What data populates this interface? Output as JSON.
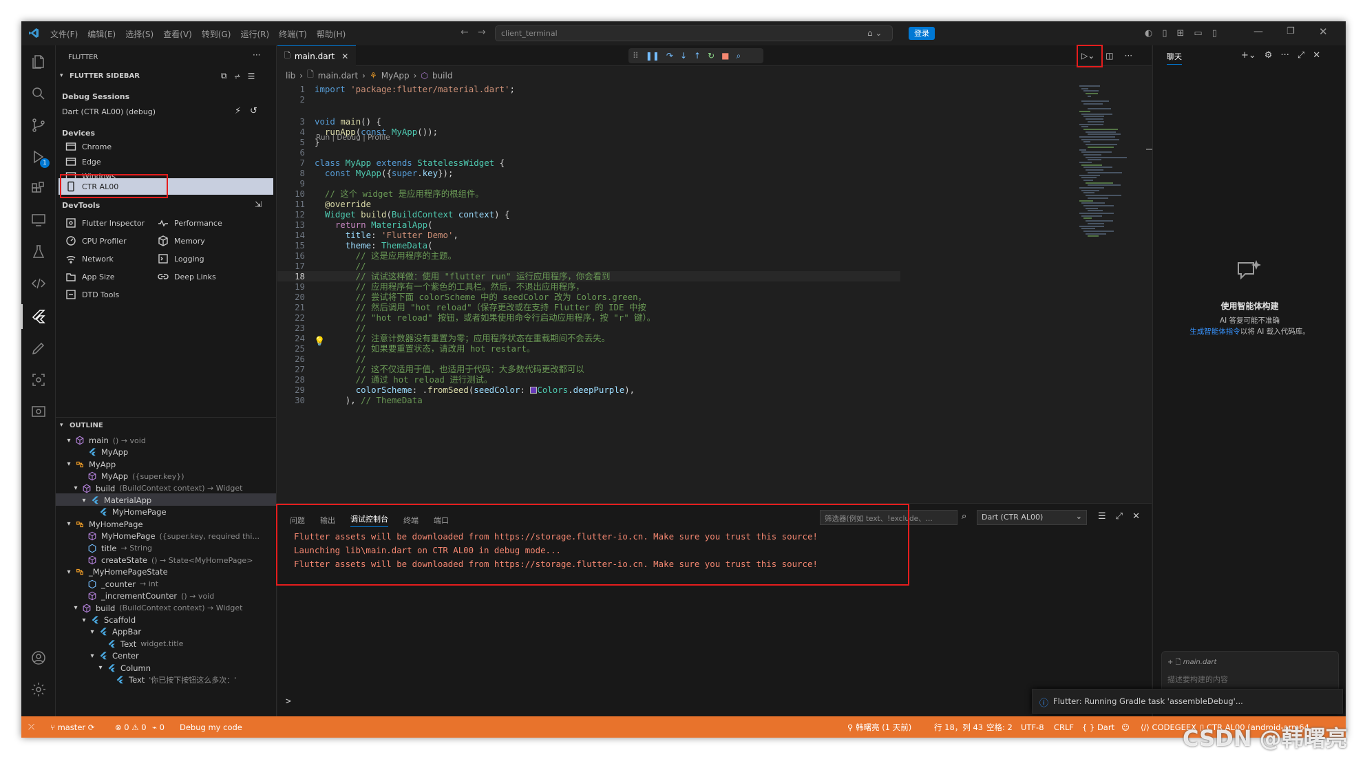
{
  "titlebar": {
    "menus": [
      "文件(F)",
      "编辑(E)",
      "选择(S)",
      "查看(V)",
      "转到(G)",
      "运行(R)",
      "终端(T)",
      "帮助(H)"
    ],
    "search_placeholder": "client_terminal",
    "login_label": "登录"
  },
  "sidebar": {
    "header": "FLUTTER",
    "section_title": "FLUTTER SIDEBAR",
    "debug_sessions_label": "Debug Sessions",
    "debug_session": "Dart  (CTR AL00) (debug)",
    "devices_label": "Devices",
    "devices": [
      "Chrome",
      "Edge",
      "Windows",
      "CTR AL00"
    ],
    "devtools_label": "DevTools",
    "devtools_left": [
      "Flutter Inspector",
      "CPU Profiler",
      "Network",
      "App Size",
      "DTD Tools"
    ],
    "devtools_right": [
      "Performance",
      "Memory",
      "Logging",
      "Deep Links"
    ]
  },
  "outline": {
    "header": "OUTLINE",
    "items": [
      {
        "label": "main",
        "detail": "() → void"
      },
      {
        "label": "MyApp",
        "detail": ""
      },
      {
        "label": "MyApp",
        "detail": ""
      },
      {
        "label": "MyApp",
        "detail": "({super.key})"
      },
      {
        "label": "build",
        "detail": "(BuildContext context) → Widget"
      },
      {
        "label": "MaterialApp",
        "detail": ""
      },
      {
        "label": "MyHomePage",
        "detail": ""
      },
      {
        "label": "MyHomePage",
        "detail": ""
      },
      {
        "label": "MyHomePage",
        "detail": "({super.key, required thi..."
      },
      {
        "label": "title",
        "detail": "→ String"
      },
      {
        "label": "createState",
        "detail": "() → State<MyHomePage>"
      },
      {
        "label": "_MyHomePageState",
        "detail": ""
      },
      {
        "label": "_counter",
        "detail": "→ int"
      },
      {
        "label": "_incrementCounter",
        "detail": "() → void"
      },
      {
        "label": "build",
        "detail": "(BuildContext context) → Widget"
      },
      {
        "label": "Scaffold",
        "detail": ""
      },
      {
        "label": "AppBar",
        "detail": ""
      },
      {
        "label": "Text",
        "detail": "widget.title"
      },
      {
        "label": "Center",
        "detail": ""
      },
      {
        "label": "Column",
        "detail": ""
      },
      {
        "label": "Text",
        "detail": "'你已按下按钮这么多次：'"
      }
    ]
  },
  "editor": {
    "tab_label": "main.dart",
    "breadcrumb": [
      "lib",
      "main.dart",
      "MyApp",
      "build"
    ],
    "codelens": "Run | Debug | Profile"
  },
  "code": [
    {
      "n": "1",
      "t": [
        [
          "kw",
          "import "
        ],
        [
          "st",
          "'package:flutter/material.dart'"
        ],
        [
          "pl",
          ";"
        ]
      ]
    },
    {
      "n": "2",
      "t": []
    },
    {
      "n": "3",
      "t": [
        [
          "kw",
          "void "
        ],
        [
          "fn",
          "main"
        ],
        [
          "pl",
          "() {"
        ]
      ]
    },
    {
      "n": "4",
      "t": [
        [
          "pl",
          "  "
        ],
        [
          "fn",
          "runApp"
        ],
        [
          "pl",
          "("
        ],
        [
          "kw",
          "const "
        ],
        [
          "ty",
          "MyApp"
        ],
        [
          "pl",
          "());"
        ]
      ]
    },
    {
      "n": "5",
      "t": [
        [
          "pl",
          "}"
        ]
      ]
    },
    {
      "n": "6",
      "t": []
    },
    {
      "n": "7",
      "t": [
        [
          "kw",
          "class "
        ],
        [
          "ty",
          "MyApp "
        ],
        [
          "kw",
          "extends "
        ],
        [
          "ty",
          "StatelessWidget "
        ],
        [
          "pl",
          "{"
        ]
      ]
    },
    {
      "n": "8",
      "t": [
        [
          "pl",
          "  "
        ],
        [
          "kw",
          "const "
        ],
        [
          "ty",
          "MyApp"
        ],
        [
          "pl",
          "({"
        ],
        [
          "kw",
          "super"
        ],
        [
          "pl",
          "."
        ],
        [
          "pm",
          "key"
        ],
        [
          "pl",
          "});"
        ]
      ]
    },
    {
      "n": "9",
      "t": []
    },
    {
      "n": "10",
      "t": [
        [
          "cm",
          "  // 这个 widget 是应用程序的根组件。"
        ]
      ]
    },
    {
      "n": "11",
      "t": [
        [
          "pl",
          "  "
        ],
        [
          "fn",
          "@override"
        ]
      ]
    },
    {
      "n": "12",
      "t": [
        [
          "pl",
          "  "
        ],
        [
          "ty",
          "Widget "
        ],
        [
          "fn",
          "build"
        ],
        [
          "pl",
          "("
        ],
        [
          "ty",
          "BuildContext "
        ],
        [
          "pm",
          "context"
        ],
        [
          "pl",
          ") {"
        ]
      ]
    },
    {
      "n": "13",
      "t": [
        [
          "pl",
          "    "
        ],
        [
          "ctrl",
          "return "
        ],
        [
          "ty",
          "MaterialApp"
        ],
        [
          "pl",
          "("
        ]
      ]
    },
    {
      "n": "14",
      "t": [
        [
          "pl",
          "      "
        ],
        [
          "pm",
          "title"
        ],
        [
          "pl",
          ": "
        ],
        [
          "st",
          "'Flutter Demo'"
        ],
        [
          "pl",
          ","
        ]
      ]
    },
    {
      "n": "15",
      "t": [
        [
          "pl",
          "      "
        ],
        [
          "pm",
          "theme"
        ],
        [
          "pl",
          ": "
        ],
        [
          "ty",
          "ThemeData"
        ],
        [
          "pl",
          "("
        ]
      ]
    },
    {
      "n": "16",
      "t": [
        [
          "cm",
          "        // 这是应用程序的主题。"
        ]
      ]
    },
    {
      "n": "17",
      "t": [
        [
          "cm",
          "        //"
        ]
      ]
    },
    {
      "n": "18",
      "t": [
        [
          "cm",
          "        // 试试这样做：使用 \"flutter run\" 运行应用程序，你会看到"
        ]
      ]
    },
    {
      "n": "19",
      "t": [
        [
          "cm",
          "        // 应用程序有一个紫色的工具栏。然后，不退出应用程序，"
        ]
      ]
    },
    {
      "n": "20",
      "t": [
        [
          "cm",
          "        // 尝试将下面 colorScheme 中的 seedColor 改为 Colors.green，"
        ]
      ]
    },
    {
      "n": "21",
      "t": [
        [
          "cm",
          "        // 然后调用 \"hot reload\"（保存更改或在支持 Flutter 的 IDE 中按"
        ]
      ]
    },
    {
      "n": "22",
      "t": [
        [
          "cm",
          "        // \"hot reload\" 按钮，或者如果使用命令行启动应用程序，按 \"r\" 键）。"
        ]
      ]
    },
    {
      "n": "23",
      "t": [
        [
          "cm",
          "        //"
        ]
      ]
    },
    {
      "n": "24",
      "t": [
        [
          "cm",
          "        // 注意计数器没有重置为零；应用程序状态在重载期间不会丢失。"
        ]
      ]
    },
    {
      "n": "25",
      "t": [
        [
          "cm",
          "        // 如果要重置状态，请改用 hot restart。"
        ]
      ]
    },
    {
      "n": "26",
      "t": [
        [
          "cm",
          "        //"
        ]
      ]
    },
    {
      "n": "27",
      "t": [
        [
          "cm",
          "        // 这不仅适用于值，也适用于代码：大多数代码更改都可以"
        ]
      ]
    },
    {
      "n": "28",
      "t": [
        [
          "cm",
          "        // 通过 hot reload 进行测试。"
        ]
      ]
    },
    {
      "n": "29",
      "t": [
        [
          "pl",
          "        "
        ],
        [
          "pm",
          "colorScheme"
        ],
        [
          "pl",
          ": ."
        ],
        [
          "fn",
          "fromSeed"
        ],
        [
          "pl",
          "("
        ],
        [
          "pm",
          "seedColor"
        ],
        [
          "pl",
          ": ▇"
        ],
        [
          "ty",
          "Colors"
        ],
        [
          "pl",
          "."
        ],
        [
          "pm",
          "deepPurple"
        ],
        [
          "pl",
          "),"
        ]
      ]
    },
    {
      "n": "30",
      "t": [
        [
          "pl",
          "      ), "
        ],
        [
          "cm",
          "// ThemeData"
        ]
      ]
    }
  ],
  "panel": {
    "tabs": [
      "问题",
      "输出",
      "调试控制台",
      "终端",
      "端口"
    ],
    "filter_placeholder": "筛选器(例如 text、!exclude、...",
    "session_select": "Dart (CTR AL00)",
    "lines": [
      "Flutter assets will be downloaded from https://storage.flutter-io.cn. Make sure you trust this source!",
      "Launching lib\\main.dart on CTR AL00 in debug mode...",
      "Flutter assets will be downloaded from https://storage.flutter-io.cn. Make sure you trust this source!"
    ],
    "prompt": ">"
  },
  "chat": {
    "title": "聊天",
    "heading": "使用智能体构建",
    "sub1": "AI 答复可能不准确",
    "link": "生成智能体指令",
    "sub2": "以将 AI 载入代码库。",
    "attach_file": "main.dart",
    "input_placeholder": "描述要构建的内容"
  },
  "notification": {
    "text": "Flutter: Running Gradle task 'assembleDebug'..."
  },
  "statusbar": {
    "branch": "master",
    "errors": "0",
    "warnings": "0",
    "ports": "0",
    "debug_label": "Debug my code",
    "author": "韩曙亮 (1 天前)",
    "position": "行 18，列 43",
    "spaces": "空格: 2",
    "encoding": "UTF-8",
    "eol": "CRLF",
    "language": "Dart",
    "codegeex": "CODEGEEX",
    "device": "CTR AL00 (android-arm64"
  },
  "watermark": "CSDN @韩曙亮",
  "colors": {
    "status": "#e8732c",
    "highlight": "#e51d1d",
    "accent": "#0078d4"
  }
}
